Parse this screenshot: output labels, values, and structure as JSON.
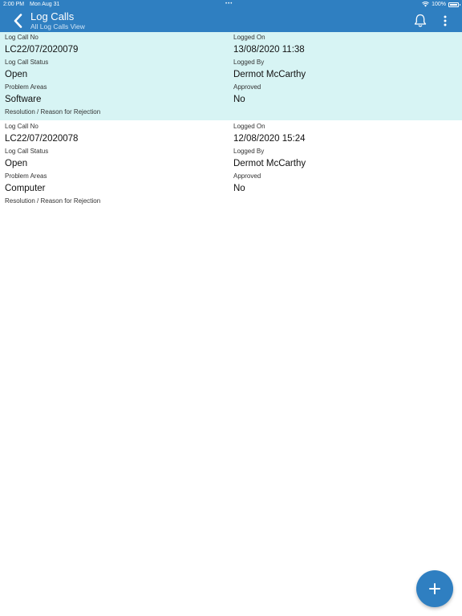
{
  "status_bar": {
    "time": "2:00 PM",
    "date": "Mon Aug 31",
    "battery": "100%"
  },
  "header": {
    "title": "Log Calls",
    "subtitle": "All Log Calls View"
  },
  "labels": {
    "log_call_no": "Log Call No",
    "logged_on": "Logged On",
    "status": "Log Call Status",
    "logged_by": "Logged By",
    "problem_areas": "Problem Areas",
    "approved": "Approved",
    "resolution": "Resolution / Reason for Rejection"
  },
  "records": [
    {
      "log_call_no": "LC22/07/2020079",
      "logged_on": "13/08/2020 11:38",
      "status": "Open",
      "logged_by": "Dermot McCarthy",
      "problem_areas": "Software",
      "approved": "No",
      "resolution": ""
    },
    {
      "log_call_no": "LC22/07/2020078",
      "logged_on": "12/08/2020 15:24",
      "status": "Open",
      "logged_by": "Dermot McCarthy",
      "problem_areas": "Computer",
      "approved": "No",
      "resolution": ""
    }
  ],
  "colors": {
    "primary": "#2f7fc1",
    "selected_row": "#d7f4f4"
  },
  "icons": {
    "back": "chevron-left-icon",
    "notifications": "bell-icon",
    "menu": "more-vertical-icon",
    "add": "plus-icon"
  }
}
